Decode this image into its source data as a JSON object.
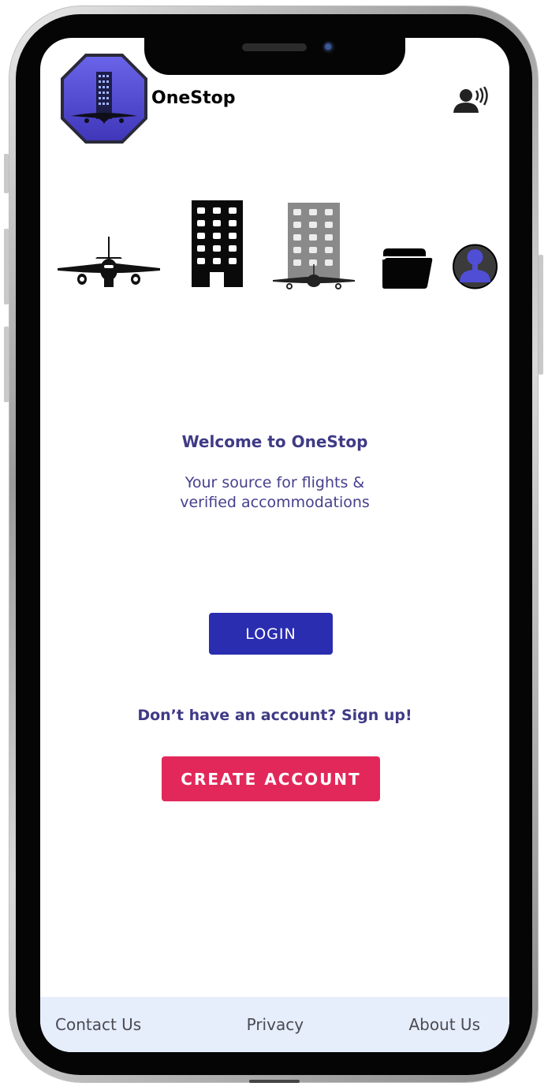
{
  "app": {
    "brand_name": "OneStop"
  },
  "header": {
    "logo_icon": "onestop-logo-icon",
    "voice_icon": "voice-assistant-icon"
  },
  "nav_icons": [
    {
      "name": "flights-icon",
      "semantic": "airplane"
    },
    {
      "name": "hotels-icon",
      "semantic": "building"
    },
    {
      "name": "flight-hotel-bundle-icon",
      "semantic": "building-with-airplane"
    },
    {
      "name": "folder-icon",
      "semantic": "open-folder"
    },
    {
      "name": "profile-icon",
      "semantic": "user-avatar"
    }
  ],
  "welcome": {
    "title": "Welcome to OneStop",
    "subtitle": "Your source for flights &\nverified accommodations"
  },
  "actions": {
    "login_label": "LOGIN",
    "signup_prompt": "Don’t have an account? Sign up!",
    "create_account_label": "CREATE ACCOUNT"
  },
  "footer": {
    "links": [
      "Contact Us",
      "Privacy",
      "About Us"
    ]
  },
  "colors": {
    "primary": "#2a2db0",
    "accent": "#e2285a",
    "text_primary": "#3f3a86",
    "footer_bg": "#e6edfb",
    "logo_fill": "#5a4fd6"
  }
}
